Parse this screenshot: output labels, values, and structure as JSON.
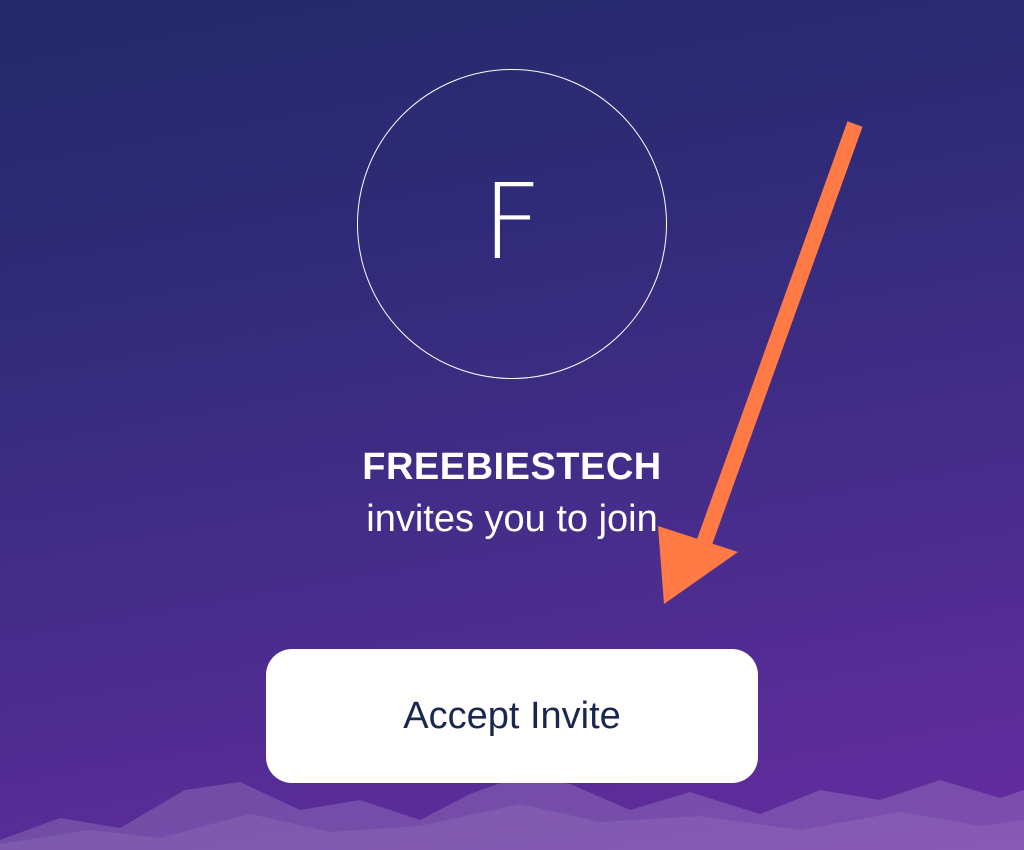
{
  "invite": {
    "avatar_letter": "F",
    "team_name": "FREEBIESTECH",
    "invite_text": "invites you to join",
    "accept_label": "Accept Invite"
  },
  "colors": {
    "background_top": "#24296a",
    "background_bottom": "#662ba0",
    "button_bg": "#ffffff",
    "button_text": "#1a2850",
    "arrow": "#ff7a45"
  },
  "icons": {
    "annotation": "arrow-down-left-icon"
  }
}
